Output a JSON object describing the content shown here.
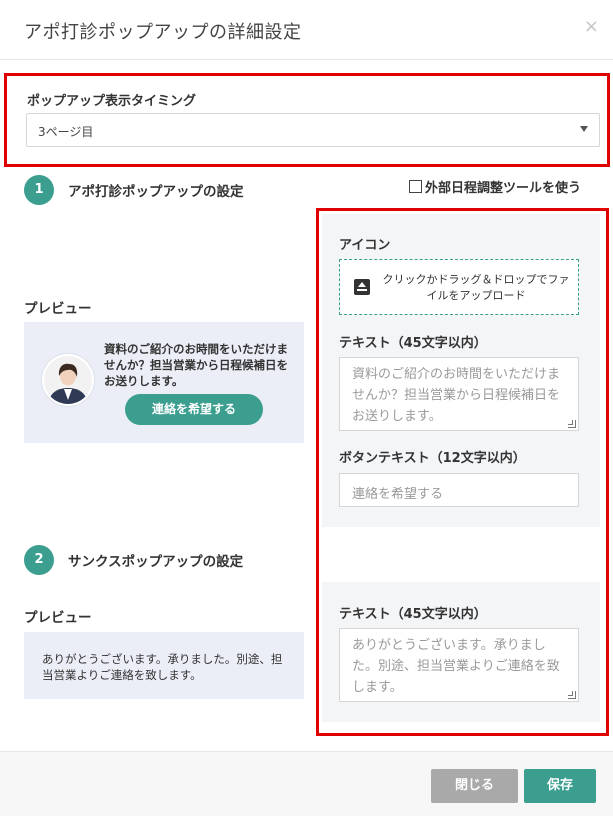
{
  "header": {
    "title": "アポ打診ポップアップの詳細設定",
    "close_icon": "×"
  },
  "timing": {
    "label": "ポップアップ表示タイミング",
    "selected": "3ページ目"
  },
  "section1": {
    "number": "1",
    "title": "アポ打診ポップアップの設定",
    "external_tool_label": "外部日程調整ツールを使う",
    "preview_label": "プレビュー",
    "preview_text": "資料のご紹介のお時間をいただけませんか？担当営業から日程候補日をお送りします。",
    "preview_button": "連絡を希望する",
    "icon_label": "アイコン",
    "upload_text": "クリックかドラッグ＆ドロップでファイルをアップロード",
    "text_label": "テキスト（45文字以内）",
    "text_placeholder": "資料のご紹介のお時間をいただけませんか？担当営業から日程候補日をお送りします。",
    "button_text_label": "ボタンテキスト（12文字以内）",
    "button_text_placeholder": "連絡を希望する"
  },
  "section2": {
    "number": "2",
    "title": "サンクスポップアップの設定",
    "preview_label": "プレビュー",
    "preview_text": "ありがとうございます。承りました。別途、担当営業よりご連絡を致します。",
    "text_label": "テキスト（45文字以内）",
    "text_placeholder": "ありがとうございます。承りました。別途、担当営業よりご連絡を致します。"
  },
  "footer": {
    "close_label": "閉じる",
    "save_label": "保存"
  },
  "colors": {
    "accent": "#3b9e8f",
    "highlight": "#e00000",
    "preview_bg": "#ebeef7"
  }
}
